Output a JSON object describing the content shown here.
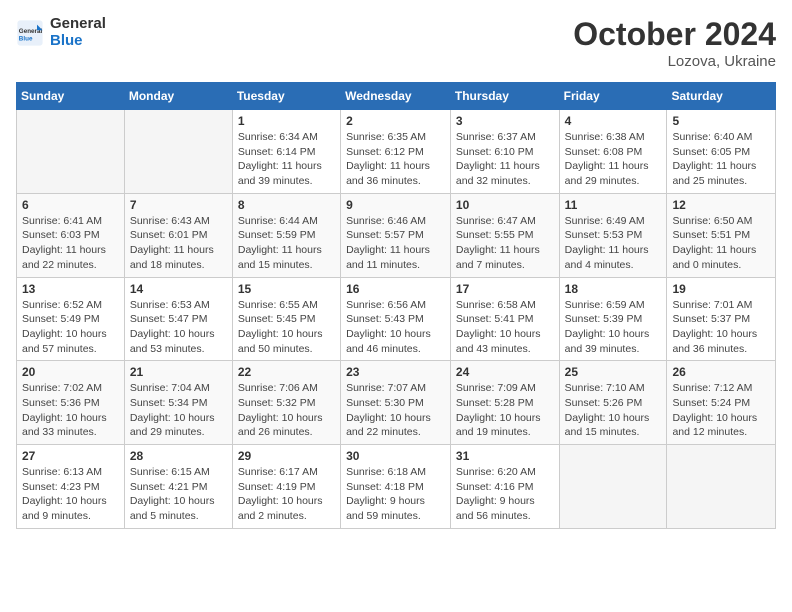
{
  "header": {
    "logo_line1": "General",
    "logo_line2": "Blue",
    "title": "October 2024",
    "subtitle": "Lozova, Ukraine"
  },
  "weekdays": [
    "Sunday",
    "Monday",
    "Tuesday",
    "Wednesday",
    "Thursday",
    "Friday",
    "Saturday"
  ],
  "weeks": [
    [
      {
        "day": "",
        "detail": ""
      },
      {
        "day": "",
        "detail": ""
      },
      {
        "day": "1",
        "detail": "Sunrise: 6:34 AM\nSunset: 6:14 PM\nDaylight: 11 hours and 39 minutes."
      },
      {
        "day": "2",
        "detail": "Sunrise: 6:35 AM\nSunset: 6:12 PM\nDaylight: 11 hours and 36 minutes."
      },
      {
        "day": "3",
        "detail": "Sunrise: 6:37 AM\nSunset: 6:10 PM\nDaylight: 11 hours and 32 minutes."
      },
      {
        "day": "4",
        "detail": "Sunrise: 6:38 AM\nSunset: 6:08 PM\nDaylight: 11 hours and 29 minutes."
      },
      {
        "day": "5",
        "detail": "Sunrise: 6:40 AM\nSunset: 6:05 PM\nDaylight: 11 hours and 25 minutes."
      }
    ],
    [
      {
        "day": "6",
        "detail": "Sunrise: 6:41 AM\nSunset: 6:03 PM\nDaylight: 11 hours and 22 minutes."
      },
      {
        "day": "7",
        "detail": "Sunrise: 6:43 AM\nSunset: 6:01 PM\nDaylight: 11 hours and 18 minutes."
      },
      {
        "day": "8",
        "detail": "Sunrise: 6:44 AM\nSunset: 5:59 PM\nDaylight: 11 hours and 15 minutes."
      },
      {
        "day": "9",
        "detail": "Sunrise: 6:46 AM\nSunset: 5:57 PM\nDaylight: 11 hours and 11 minutes."
      },
      {
        "day": "10",
        "detail": "Sunrise: 6:47 AM\nSunset: 5:55 PM\nDaylight: 11 hours and 7 minutes."
      },
      {
        "day": "11",
        "detail": "Sunrise: 6:49 AM\nSunset: 5:53 PM\nDaylight: 11 hours and 4 minutes."
      },
      {
        "day": "12",
        "detail": "Sunrise: 6:50 AM\nSunset: 5:51 PM\nDaylight: 11 hours and 0 minutes."
      }
    ],
    [
      {
        "day": "13",
        "detail": "Sunrise: 6:52 AM\nSunset: 5:49 PM\nDaylight: 10 hours and 57 minutes."
      },
      {
        "day": "14",
        "detail": "Sunrise: 6:53 AM\nSunset: 5:47 PM\nDaylight: 10 hours and 53 minutes."
      },
      {
        "day": "15",
        "detail": "Sunrise: 6:55 AM\nSunset: 5:45 PM\nDaylight: 10 hours and 50 minutes."
      },
      {
        "day": "16",
        "detail": "Sunrise: 6:56 AM\nSunset: 5:43 PM\nDaylight: 10 hours and 46 minutes."
      },
      {
        "day": "17",
        "detail": "Sunrise: 6:58 AM\nSunset: 5:41 PM\nDaylight: 10 hours and 43 minutes."
      },
      {
        "day": "18",
        "detail": "Sunrise: 6:59 AM\nSunset: 5:39 PM\nDaylight: 10 hours and 39 minutes."
      },
      {
        "day": "19",
        "detail": "Sunrise: 7:01 AM\nSunset: 5:37 PM\nDaylight: 10 hours and 36 minutes."
      }
    ],
    [
      {
        "day": "20",
        "detail": "Sunrise: 7:02 AM\nSunset: 5:36 PM\nDaylight: 10 hours and 33 minutes."
      },
      {
        "day": "21",
        "detail": "Sunrise: 7:04 AM\nSunset: 5:34 PM\nDaylight: 10 hours and 29 minutes."
      },
      {
        "day": "22",
        "detail": "Sunrise: 7:06 AM\nSunset: 5:32 PM\nDaylight: 10 hours and 26 minutes."
      },
      {
        "day": "23",
        "detail": "Sunrise: 7:07 AM\nSunset: 5:30 PM\nDaylight: 10 hours and 22 minutes."
      },
      {
        "day": "24",
        "detail": "Sunrise: 7:09 AM\nSunset: 5:28 PM\nDaylight: 10 hours and 19 minutes."
      },
      {
        "day": "25",
        "detail": "Sunrise: 7:10 AM\nSunset: 5:26 PM\nDaylight: 10 hours and 15 minutes."
      },
      {
        "day": "26",
        "detail": "Sunrise: 7:12 AM\nSunset: 5:24 PM\nDaylight: 10 hours and 12 minutes."
      }
    ],
    [
      {
        "day": "27",
        "detail": "Sunrise: 6:13 AM\nSunset: 4:23 PM\nDaylight: 10 hours and 9 minutes."
      },
      {
        "day": "28",
        "detail": "Sunrise: 6:15 AM\nSunset: 4:21 PM\nDaylight: 10 hours and 5 minutes."
      },
      {
        "day": "29",
        "detail": "Sunrise: 6:17 AM\nSunset: 4:19 PM\nDaylight: 10 hours and 2 minutes."
      },
      {
        "day": "30",
        "detail": "Sunrise: 6:18 AM\nSunset: 4:18 PM\nDaylight: 9 hours and 59 minutes."
      },
      {
        "day": "31",
        "detail": "Sunrise: 6:20 AM\nSunset: 4:16 PM\nDaylight: 9 hours and 56 minutes."
      },
      {
        "day": "",
        "detail": ""
      },
      {
        "day": "",
        "detail": ""
      }
    ]
  ]
}
